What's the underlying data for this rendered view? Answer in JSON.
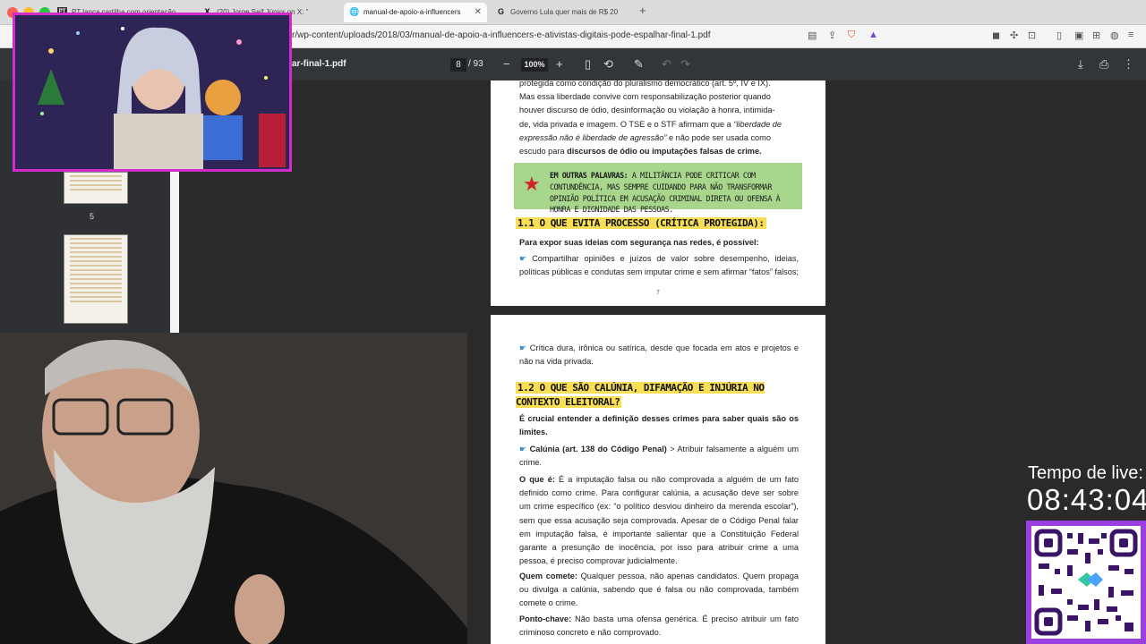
{
  "browser": {
    "tabs": [
      {
        "favicon": "PT",
        "title": "PT lança cartilha com orientação"
      },
      {
        "favicon": "X",
        "title": "(20) Jorge Seif Júnior on X: \""
      },
      {
        "favicon": "🌐",
        "title": "manual-de-apoio-a-influencers"
      },
      {
        "favicon": "G",
        "title": "Governo Lula quer mais de R$ 20"
      }
    ],
    "url": "r/wp-content/uploads/2018/03/manual-de-apoio-a-influencers-e-ativistas-digitais-pode-espalhar-final-1.pdf"
  },
  "pdf": {
    "filename": "ar-final-1.pdf",
    "current_page": "8",
    "total_pages": "/ 93",
    "zoom": "100%",
    "thumb_label": "5",
    "page7": {
      "lines": [
        "protegida como condição do pluralismo democrático (art. 5º, IV e IX).",
        "Mas essa liberdade convive com responsabilização posterior quando",
        "houver discurso de ódio, desinformação ou violação à honra, intimida-"
      ],
      "l4_pre": "de, vida privada e imagem. O TSE e o STF afirmam que a ",
      "l4_em": "“liberdade de",
      "l5_em": "expressão não é liberdade de agressão”",
      "l5_post": " e não pode ser usada como",
      "l6_pre": "escudo para ",
      "l6_bold": "discursos de ódio ou imputações falsas de crime.",
      "callout_label": "EM OUTRAS PALAVRAS:",
      "callout_text": " A MILITÂNCIA PODE CRITICAR COM CONTUNDÊNCIA, MAS SEMPRE CUIDANDO PARA NÃO TRANSFORMAR OPINIÃO POLÍTICA EM ACUSAÇÃO CRIMINAL DIRETA OU OFENSA À HONRA E DIGNIDADE DAS PESSOAS.",
      "heading": "1.1 O QUE EVITA PROCESSO (CRÍTICA PROTEGIDA):",
      "intro": "Para expor suas ideias com segurança nas redes, é possível:",
      "bullet": "Compartilhar opiniões e juízos de valor sobre desempenho, ideias, políticas públicas e condutas sem imputar crime e sem afirmar “fatos” falsos;",
      "page_number": "7"
    },
    "page8": {
      "bullet1": "Crítica dura, irônica ou satírica, desde que focada em atos e projetos e não na vida privada.",
      "heading": "1.2 O QUE SÃO CALÚNIA, DIFAMAÇÃO E INJÚRIA NO CONTEXTO ELEITORAL?",
      "intro": "É crucial entender a definição desses crimes para saber quais são os limites.",
      "b2_bold": "Calúnia (art. 138 do Código Penal)",
      "b2_rest": " > Atribuir falsamente a alguém um crime.",
      "p1_bold": "O que é:",
      "p1": " É a imputação falsa ou não comprovada a alguém de um fato definido como crime. Para configurar calúnia, a acusação deve ser sobre um crime específico (ex: “o político desviou dinheiro da merenda escolar”), sem que essa acusação seja comprovada. Apesar de o Código Penal falar em imputação falsa, é importante salientar que a Constituição Federal garante a presunção de inocência, por isso para atribuir crime a uma pessoa, é preciso comprovar judicialmente.",
      "p2_bold": "Quem comete:",
      "p2": " Qualquer pessoa, não apenas candidatos. Quem propaga ou divulga a calúnia, sabendo que é falsa ou não comprovada, também comete o crime.",
      "p3_bold": "Ponto-chave:",
      "p3": " Não basta uma ofensa genérica. É preciso atribuir um fato criminoso concreto e não comprovado."
    }
  },
  "overlay": {
    "live_label": "Tempo de live:",
    "live_time": "08:43:04"
  },
  "colors": {
    "callout_bg": "#a7d68c",
    "heading_highlight": "#f7de54",
    "star": "#d2232a",
    "cam_border": "#cf2cc9",
    "qr_frame": "#9b3fe0"
  }
}
